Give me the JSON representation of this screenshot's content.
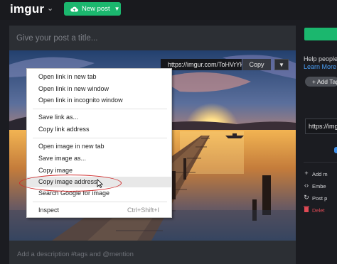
{
  "topbar": {
    "logo": "imgur",
    "new_post_label": "New post"
  },
  "editor": {
    "title_placeholder": "Give your post a title...",
    "description_placeholder": "Add a description #tags and @mention",
    "image_link": "https://imgur.com/ToHVrYk",
    "copy_label": "Copy"
  },
  "context_menu": {
    "items": [
      {
        "label": "Open link in new tab"
      },
      {
        "label": "Open link in new window"
      },
      {
        "label": "Open link in incognito window"
      },
      {
        "label": "Save link as..."
      },
      {
        "label": "Copy link address"
      },
      {
        "label": "Open image in new tab"
      },
      {
        "label": "Save image as..."
      },
      {
        "label": "Copy image"
      },
      {
        "label": "Copy image address",
        "highlighted": true
      },
      {
        "label": "Search Google for image"
      },
      {
        "label": "Inspect",
        "shortcut": "Ctrl+Shift+I"
      }
    ]
  },
  "sidebar": {
    "help_text": "Help people",
    "learn_more": "Learn More",
    "add_tag": "Add Tag",
    "url_value": "https://imgur",
    "actions": [
      {
        "icon": "plus-icon",
        "label": "Add m"
      },
      {
        "icon": "embed-icon",
        "label": "Embe"
      },
      {
        "icon": "post-icon",
        "label": "Post p"
      },
      {
        "icon": "trash-icon",
        "label": "Delet"
      }
    ]
  },
  "colors": {
    "accent_green": "#1bb76e",
    "link_blue": "#4a9ef5",
    "delete_red": "#e04a55",
    "highlight_oval": "#d02a2a"
  }
}
